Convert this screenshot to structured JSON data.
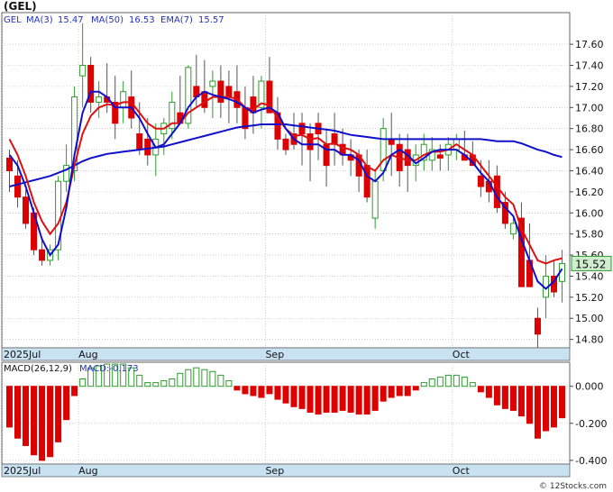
{
  "header": {
    "title": "(GEL)",
    "legend": [
      {
        "text": "GEL",
        "color": "#2233bb"
      },
      {
        "text": "MA(3)",
        "color": "#2233bb"
      },
      {
        "text": "15.47",
        "color": "#2233bb"
      },
      {
        "text": "MA(50)",
        "color": "#2233bb"
      },
      {
        "text": "16.53",
        "color": "#2233bb"
      },
      {
        "text": "EMA(7)",
        "color": "#2233bb"
      },
      {
        "text": "15.57",
        "color": "#2233bb"
      }
    ]
  },
  "macd_header": {
    "label": "MACD(26,12,9)",
    "value_label": "MACD:-0.173"
  },
  "last_price_label": "15.52",
  "footer": "© 12Stocks.com",
  "colors": {
    "up_candle": "#2e9b2e",
    "down_candle": "#dd0000",
    "ma3": "#1010cc",
    "ma50": "#1010cc",
    "ema7": "#dd1111",
    "macd_pos": "#2e9b2e",
    "macd_neg": "#dd0000",
    "axis_band": "#c8e2f2",
    "grid": "#b0b0b0",
    "price_box": "#cfeecf"
  },
  "chart_data": [
    {
      "type": "candlestick",
      "title": "(GEL)",
      "y_ticks": [
        "17.60",
        "17.40",
        "17.20",
        "17.00",
        "16.80",
        "16.60",
        "16.40",
        "16.20",
        "16.00",
        "15.80",
        "15.60",
        "15.40",
        "15.20",
        "15.00",
        "14.80"
      ],
      "ylim": [
        14.72,
        17.9
      ],
      "x_labels": [
        {
          "label": "2025Jul",
          "index": 0
        },
        {
          "label": "Aug",
          "index": 9
        },
        {
          "label": "Sep",
          "index": 32
        },
        {
          "label": "Oct",
          "index": 55
        }
      ],
      "grid": true,
      "ohlc": [
        [
          16.52,
          16.6,
          16.2,
          16.4
        ],
        [
          16.35,
          16.5,
          16.05,
          16.15
        ],
        [
          16.15,
          16.22,
          15.85,
          15.9
        ],
        [
          16.0,
          16.05,
          15.6,
          15.65
        ],
        [
          15.65,
          15.75,
          15.5,
          15.55
        ],
        [
          15.55,
          15.7,
          15.5,
          15.65
        ],
        [
          15.65,
          16.35,
          15.55,
          16.3
        ],
        [
          16.3,
          16.65,
          16.2,
          16.45
        ],
        [
          16.4,
          17.2,
          16.3,
          17.1
        ],
        [
          17.3,
          17.8,
          17.0,
          17.4
        ],
        [
          17.4,
          17.48,
          16.95,
          17.05
        ],
        [
          17.05,
          17.25,
          16.9,
          17.1
        ],
        [
          17.1,
          17.42,
          16.95,
          17.05
        ],
        [
          17.05,
          17.3,
          16.7,
          16.85
        ],
        [
          17.0,
          17.25,
          16.85,
          17.15
        ],
        [
          17.1,
          17.35,
          16.8,
          16.9
        ],
        [
          16.75,
          17.05,
          16.55,
          16.6
        ],
        [
          16.7,
          16.9,
          16.45,
          16.55
        ],
        [
          16.55,
          16.85,
          16.35,
          16.7
        ],
        [
          16.75,
          16.9,
          16.55,
          16.85
        ],
        [
          16.8,
          17.15,
          16.7,
          17.05
        ],
        [
          16.95,
          17.3,
          16.85,
          16.85
        ],
        [
          16.85,
          17.4,
          16.8,
          17.38
        ],
        [
          17.2,
          17.5,
          17.0,
          17.1
        ],
        [
          17.15,
          17.45,
          16.95,
          17.0
        ],
        [
          17.2,
          17.35,
          16.9,
          17.25
        ],
        [
          17.25,
          17.4,
          16.9,
          17.05
        ],
        [
          17.2,
          17.35,
          16.85,
          17.1
        ],
        [
          17.15,
          17.4,
          16.85,
          17.0
        ],
        [
          17.0,
          17.2,
          16.7,
          16.8
        ],
        [
          17.1,
          17.3,
          16.75,
          16.95
        ],
        [
          17.0,
          17.3,
          16.8,
          17.25
        ],
        [
          17.25,
          17.48,
          17.05,
          16.95
        ],
        [
          16.95,
          17.1,
          16.6,
          16.7
        ],
        [
          16.7,
          16.75,
          16.55,
          16.6
        ],
        [
          16.75,
          16.95,
          16.6,
          16.65
        ],
        [
          16.85,
          16.95,
          16.45,
          16.75
        ],
        [
          16.75,
          16.85,
          16.3,
          16.6
        ],
        [
          16.85,
          16.95,
          16.5,
          16.75
        ],
        [
          16.65,
          16.8,
          16.25,
          16.45
        ],
        [
          16.75,
          16.95,
          16.45,
          16.65
        ],
        [
          16.65,
          16.8,
          16.45,
          16.55
        ],
        [
          16.55,
          16.7,
          16.35,
          16.5
        ],
        [
          16.55,
          16.6,
          16.2,
          16.35
        ],
        [
          16.45,
          16.6,
          16.1,
          16.15
        ],
        [
          15.95,
          16.4,
          15.85,
          16.3
        ],
        [
          16.4,
          16.9,
          16.3,
          16.8
        ],
        [
          16.7,
          16.95,
          16.35,
          16.65
        ],
        [
          16.65,
          16.75,
          16.25,
          16.4
        ],
        [
          16.6,
          16.75,
          16.2,
          16.45
        ],
        [
          16.45,
          16.65,
          16.3,
          16.55
        ],
        [
          16.5,
          16.75,
          16.4,
          16.65
        ],
        [
          16.5,
          16.72,
          16.4,
          16.6
        ],
        [
          16.55,
          16.65,
          16.4,
          16.52
        ],
        [
          16.55,
          16.72,
          16.4,
          16.65
        ],
        [
          16.6,
          16.75,
          16.5,
          16.7
        ],
        [
          16.55,
          16.78,
          16.5,
          16.5
        ],
        [
          16.55,
          16.68,
          16.45,
          16.45
        ],
        [
          16.35,
          16.5,
          16.15,
          16.25
        ],
        [
          16.3,
          16.5,
          16.1,
          16.2
        ],
        [
          16.35,
          16.45,
          16.0,
          16.05
        ],
        [
          16.1,
          16.2,
          15.85,
          15.9
        ],
        [
          15.8,
          15.95,
          15.75,
          15.9
        ],
        [
          15.95,
          16.1,
          15.4,
          15.3
        ],
        [
          15.55,
          15.9,
          15.4,
          15.3
        ],
        [
          15.0,
          15.1,
          14.72,
          14.85
        ],
        [
          15.2,
          15.6,
          15.0,
          15.4
        ],
        [
          15.4,
          15.55,
          15.2,
          15.25
        ],
        [
          15.35,
          15.65,
          15.15,
          15.52
        ]
      ],
      "ma3": [
        16.55,
        16.45,
        16.25,
        16.0,
        15.75,
        15.6,
        15.7,
        16.05,
        16.55,
        16.95,
        17.15,
        17.15,
        17.1,
        17.0,
        17.0,
        17.0,
        16.9,
        16.75,
        16.62,
        16.65,
        16.75,
        16.85,
        17.0,
        17.1,
        17.15,
        17.12,
        17.1,
        17.08,
        17.05,
        17.0,
        16.95,
        16.98,
        17.0,
        16.95,
        16.8,
        16.7,
        16.65,
        16.65,
        16.65,
        16.6,
        16.6,
        16.55,
        16.55,
        16.5,
        16.35,
        16.3,
        16.38,
        16.55,
        16.6,
        16.55,
        16.47,
        16.52,
        16.58,
        16.6,
        16.6,
        16.6,
        16.55,
        16.48,
        16.38,
        16.3,
        16.15,
        16.05,
        15.97,
        15.75,
        15.55,
        15.35,
        15.28,
        15.35,
        15.47
      ],
      "ma50": [
        16.25,
        16.27,
        16.29,
        16.31,
        16.33,
        16.35,
        16.38,
        16.41,
        16.45,
        16.49,
        16.52,
        16.54,
        16.56,
        16.57,
        16.58,
        16.59,
        16.6,
        16.61,
        16.62,
        16.63,
        16.65,
        16.67,
        16.69,
        16.71,
        16.73,
        16.75,
        16.77,
        16.79,
        16.81,
        16.82,
        16.83,
        16.84,
        16.84,
        16.84,
        16.84,
        16.83,
        16.82,
        16.81,
        16.8,
        16.79,
        16.78,
        16.76,
        16.74,
        16.73,
        16.72,
        16.71,
        16.7,
        16.7,
        16.7,
        16.7,
        16.7,
        16.7,
        16.7,
        16.7,
        16.7,
        16.7,
        16.7,
        16.7,
        16.7,
        16.69,
        16.68,
        16.68,
        16.68,
        16.66,
        16.63,
        16.6,
        16.58,
        16.55,
        16.53
      ],
      "ema7": [
        16.7,
        16.55,
        16.35,
        16.1,
        15.92,
        15.8,
        15.9,
        16.1,
        16.45,
        16.75,
        16.92,
        17.0,
        17.03,
        17.02,
        17.05,
        17.05,
        16.95,
        16.85,
        16.8,
        16.8,
        16.85,
        16.85,
        16.95,
        17.0,
        17.05,
        17.1,
        17.1,
        17.1,
        17.08,
        17.0,
        16.98,
        17.04,
        17.02,
        16.9,
        16.8,
        16.73,
        16.74,
        16.7,
        16.71,
        16.65,
        16.66,
        16.62,
        16.6,
        16.55,
        16.44,
        16.4,
        16.5,
        16.55,
        16.52,
        16.5,
        16.5,
        16.55,
        16.58,
        16.58,
        16.6,
        16.65,
        16.6,
        16.55,
        16.45,
        16.35,
        16.25,
        16.15,
        16.08,
        15.85,
        15.7,
        15.55,
        15.52,
        15.55,
        15.57
      ]
    },
    {
      "type": "bar",
      "title": "MACD(26,12,9)",
      "y_ticks": [
        "0.000",
        "-0.200",
        "-0.400"
      ],
      "ylim": [
        -0.42,
        0.13
      ],
      "x_labels": [
        {
          "label": "2025Jul",
          "index": 0
        },
        {
          "label": "Aug",
          "index": 9
        },
        {
          "label": "Sep",
          "index": 32
        },
        {
          "label": "Oct",
          "index": 55
        }
      ],
      "values": [
        -0.22,
        -0.28,
        -0.32,
        -0.37,
        -0.4,
        -0.38,
        -0.3,
        -0.18,
        -0.05,
        0.04,
        0.1,
        0.11,
        0.12,
        0.12,
        0.12,
        0.1,
        0.06,
        0.02,
        0.02,
        0.03,
        0.04,
        0.07,
        0.09,
        0.1,
        0.09,
        0.08,
        0.06,
        0.03,
        -0.02,
        -0.04,
        -0.05,
        -0.06,
        -0.04,
        -0.07,
        -0.09,
        -0.11,
        -0.12,
        -0.14,
        -0.15,
        -0.14,
        -0.14,
        -0.13,
        -0.14,
        -0.15,
        -0.15,
        -0.13,
        -0.08,
        -0.06,
        -0.05,
        -0.05,
        -0.02,
        0.02,
        0.04,
        0.05,
        0.06,
        0.06,
        0.05,
        0.02,
        -0.03,
        -0.06,
        -0.1,
        -0.12,
        -0.13,
        -0.16,
        -0.2,
        -0.28,
        -0.24,
        -0.22,
        -0.17
      ]
    }
  ]
}
